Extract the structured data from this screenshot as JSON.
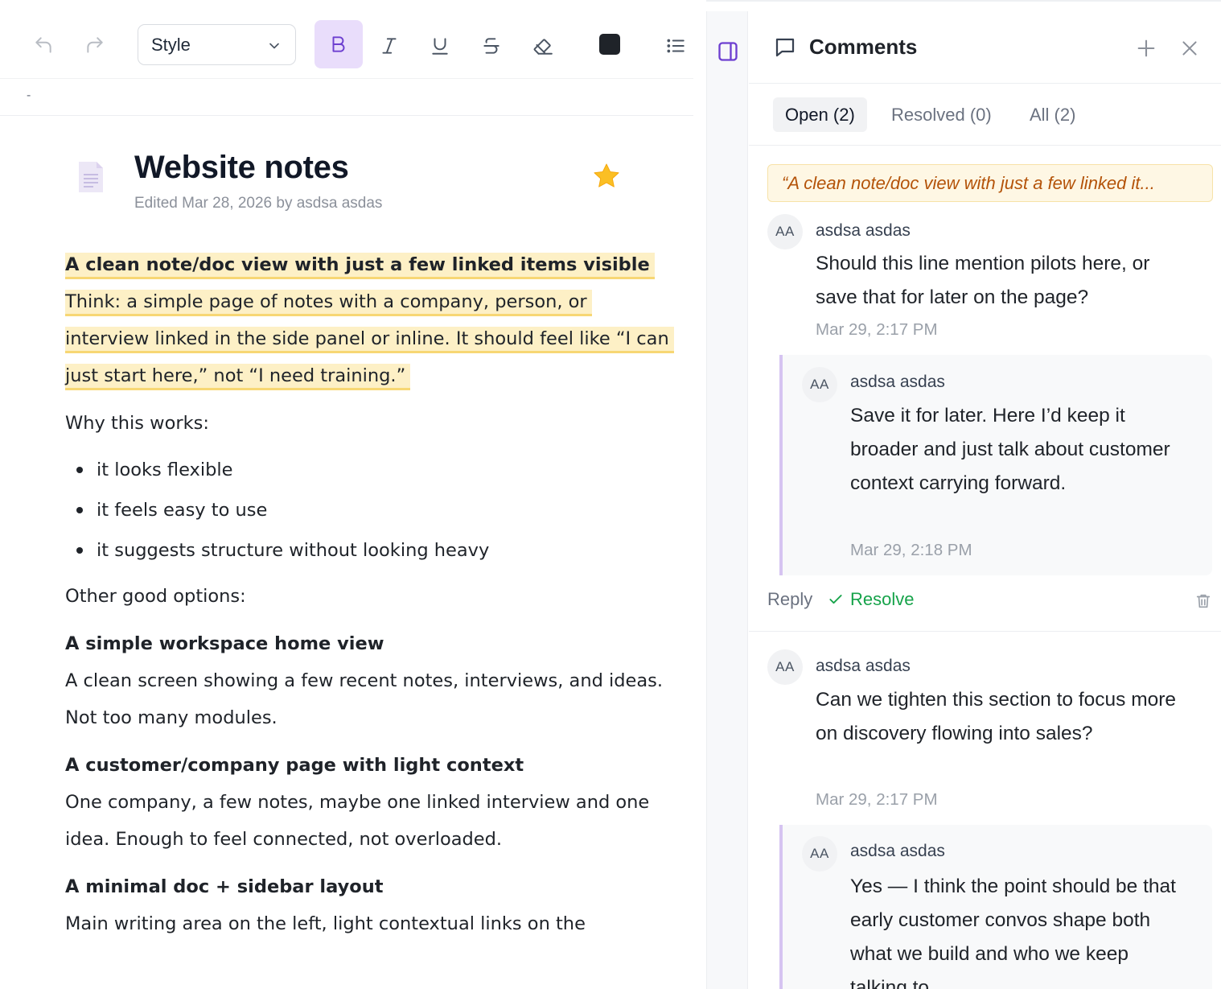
{
  "toolbar": {
    "style_label": "Style",
    "icons": [
      "undo-icon",
      "redo-icon",
      "chevron-down-icon",
      "bold-icon",
      "italic-icon",
      "underline-icon",
      "strikethrough-icon",
      "eraser-icon",
      "text-color-swatch",
      "bullet-list-icon"
    ],
    "text_color": "#1f2329",
    "active_accent": "#e9ddfb"
  },
  "ruler": {
    "marker": "-"
  },
  "doc": {
    "title": "Website notes",
    "meta": "Edited Mar 28, 2026 by asdsa asdas",
    "favorite": true,
    "highlight_heading": "A clean note/doc view with just a few linked items visible",
    "highlight_text": "Think: a simple page of notes with a company, person, or interview linked in the side panel or inline. It should feel like “I can just start here,” not “I need training.”",
    "why_label": "Why this works:",
    "bullets": [
      "it looks flexible",
      "it feels easy to use",
      "it suggests structure without looking heavy"
    ],
    "other_label": "Other good options:",
    "sections": [
      {
        "heading": "A simple workspace home view",
        "text": "A clean screen showing a few recent notes, interviews, and ideas. Not too many modules."
      },
      {
        "heading": "A customer/company page with light context",
        "text": "One company, a few notes, maybe one linked interview and one idea. Enough to feel connected, not overloaded."
      },
      {
        "heading": "A minimal doc + sidebar layout",
        "text": "Main writing area on the left, light contextual links on the"
      }
    ]
  },
  "comments": {
    "title": "Comments",
    "tabs": [
      {
        "label": "Open (2)",
        "active": true
      },
      {
        "label": "Resolved (0)",
        "active": false
      },
      {
        "label": "All (2)",
        "active": false
      }
    ],
    "quote": "“A clean note/doc view with just a few linked it...",
    "threads": [
      {
        "avatar": "AA",
        "author": "asdsa asdas",
        "text": "Should this line mention pilots here, or save that for later on the page?",
        "time": "Mar 29, 2:17 PM",
        "reply": {
          "avatar": "AA",
          "author": "asdsa asdas",
          "text": "Save it for later. Here I’d keep it broader and just talk about customer context carrying forward.",
          "time": "Mar 29, 2:18 PM"
        },
        "actions": {
          "reply": "Reply",
          "resolve": "Resolve"
        }
      },
      {
        "avatar": "AA",
        "author": "asdsa asdas",
        "text": "Can we tighten this section to focus more on discovery flowing into sales?",
        "time": "Mar 29, 2:17 PM",
        "reply": {
          "avatar": "AA",
          "author": "asdsa asdas",
          "text": "Yes — I think the point should be that early customer convos shape both what we build and who we keep talking to."
        }
      }
    ],
    "colors": {
      "quote_text": "#b45309",
      "resolve": "#16a34a",
      "reply_border": "#d6c4f1"
    }
  }
}
